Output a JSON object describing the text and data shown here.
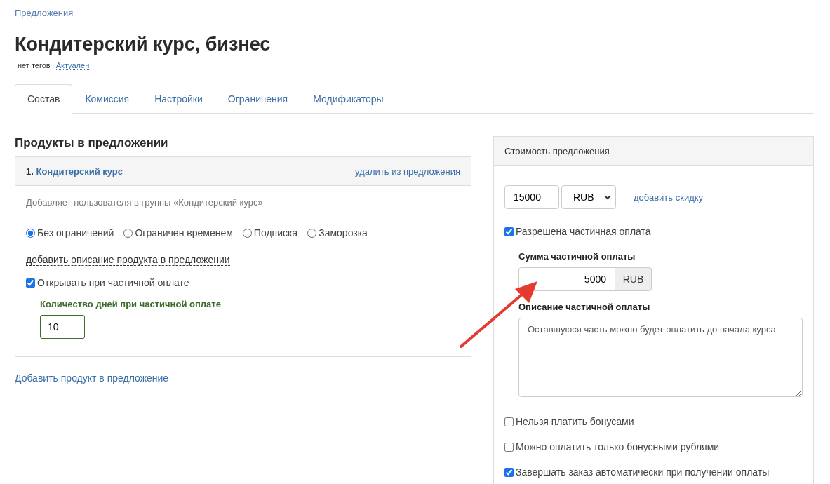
{
  "breadcrumb": "Предложения",
  "title": "Кондитерский курс, бизнес",
  "tags": "нет тегов",
  "status": "Актуален",
  "tabs": [
    {
      "label": "Состав",
      "selected": true
    },
    {
      "label": "Комиссия",
      "selected": false
    },
    {
      "label": "Настройки",
      "selected": false
    },
    {
      "label": "Ограничения",
      "selected": false
    },
    {
      "label": "Модификаторы",
      "selected": false
    }
  ],
  "products_heading": "Продукты в предложении",
  "product": {
    "number": "1.",
    "name": "Кондитерский курс",
    "remove_link": "удалить из предложения",
    "description": "Добавляет пользователя в группы «Кондитерский курс»",
    "access_options": [
      {
        "label": "Без ограничений",
        "selected": true
      },
      {
        "label": "Ограничен временем",
        "selected": false
      },
      {
        "label": "Подписка",
        "selected": false
      },
      {
        "label": "Заморозка",
        "selected": false
      }
    ],
    "add_description_link": "добавить описание продукта в предложении",
    "open_on_partial": {
      "label": "Открывать при частичной оплате",
      "checked": true
    },
    "days_label": "Количество дней при частичной оплате",
    "days_value": "10"
  },
  "add_product_link": "Добавить продукт в предложение",
  "price_panel": {
    "title": "Стоимость предложения",
    "amount": "15000",
    "currency": "RUB",
    "discount_link": "добавить скидку",
    "partial_allowed": {
      "label": "Разрешена частичная оплата",
      "checked": true
    },
    "partial_sum_label": "Сумма частичной оплаты",
    "partial_sum": "5000",
    "partial_currency": "RUB",
    "partial_desc_label": "Описание частичной оплаты",
    "partial_desc": "Оставшуюся часть можно будет оплатить до начала курса.",
    "options": [
      {
        "label": "Нельзя платить бонусами",
        "checked": false
      },
      {
        "label": "Можно оплатить только бонусными рублями",
        "checked": false
      },
      {
        "label": "Завершать заказ автоматически при получении оплаты",
        "checked": true
      }
    ]
  }
}
